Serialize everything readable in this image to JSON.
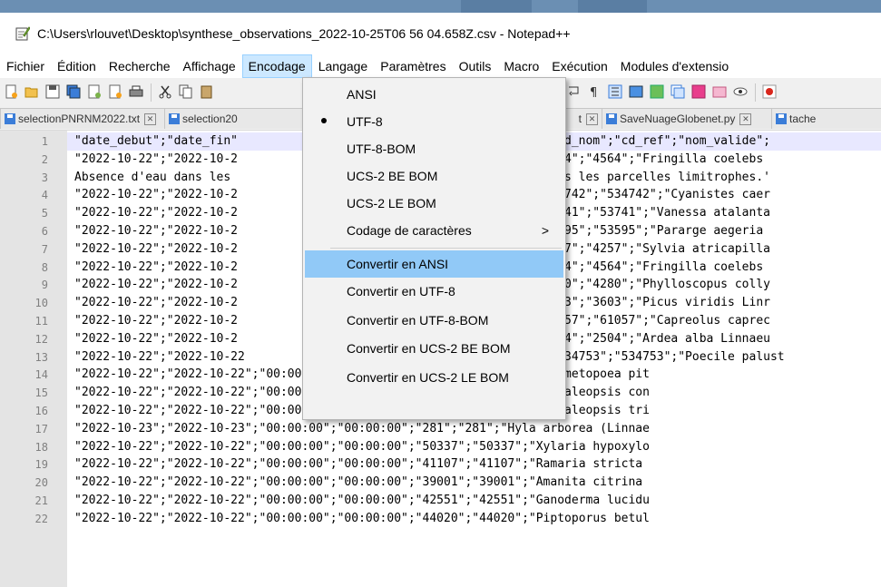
{
  "window": {
    "title": "C:\\Users\\rlouvet\\Desktop\\synthese_observations_2022-10-25T06 56 04.658Z.csv - Notepad++"
  },
  "menu": [
    "Fichier",
    "Édition",
    "Recherche",
    "Affichage",
    "Encodage",
    "Langage",
    "Paramètres",
    "Outils",
    "Macro",
    "Exécution",
    "Modules d'extensio"
  ],
  "menu_active": "Encodage",
  "tabs": [
    "selectionPNRNM2022.txt",
    "selection20",
    "t",
    "SaveNuageGlobenet.py",
    "tache"
  ],
  "dropdown": {
    "items": [
      "ANSI",
      "UTF-8",
      "UTF-8-BOM",
      "UCS-2 BE BOM",
      "UCS-2 LE BOM",
      "Codage de caractères",
      "Convertir en ANSI",
      "Convertir en UTF-8",
      "Convertir en UTF-8-BOM",
      "Convertir en UCS-2 BE BOM",
      "Convertir en UCS-2 LE BOM"
    ],
    "selected": "UTF-8",
    "highlighted": "Convertir en ANSI",
    "submenu_arrow": ">"
  },
  "editor": {
    "lines": [
      {
        "n": "1",
        "left": "\"date_debut\";\"date_fin\"",
        "right": "d_nom\";\"cd_ref\";\"nom_valide\";"
      },
      {
        "n": "2",
        "left": "\"2022-10-22\";\"2022-10-2",
        "right": "4\";\"4564\";\"Fringilla coelebs"
      },
      {
        "n": "3",
        "left": "Absence d'eau dans les",
        "right": "s les parcelles limitrophes.'"
      },
      {
        "n": "4",
        "left": "\"2022-10-22\";\"2022-10-2",
        "right": "742\";\"534742\";\"Cyanistes caer"
      },
      {
        "n": "5",
        "left": "\"2022-10-22\";\"2022-10-2",
        "right": "41\";\"53741\";\"Vanessa atalanta"
      },
      {
        "n": "6",
        "left": "\"2022-10-22\";\"2022-10-2",
        "right": "95\";\"53595\";\"Pararge aegeria"
      },
      {
        "n": "7",
        "left": "\"2022-10-22\";\"2022-10-2",
        "right": "7\";\"4257\";\"Sylvia atricapilla"
      },
      {
        "n": "8",
        "left": "\"2022-10-22\";\"2022-10-2",
        "right": "4\";\"4564\";\"Fringilla coelebs"
      },
      {
        "n": "9",
        "left": "\"2022-10-22\";\"2022-10-2",
        "right": "0\";\"4280\";\"Phylloscopus colly"
      },
      {
        "n": "10",
        "left": "\"2022-10-22\";\"2022-10-2",
        "right": "3\";\"3603\";\"Picus viridis Linr"
      },
      {
        "n": "11",
        "left": "\"2022-10-22\";\"2022-10-2",
        "right": "57\";\"61057\";\"Capreolus caprec"
      },
      {
        "n": "12",
        "left": "\"2022-10-22\";\"2022-10-2",
        "right": "4\";\"2504\";\"Ardea alba Linnaeu"
      },
      {
        "n": "13",
        "left": "\"2022-10-22\";\"2022-10-22",
        "right": "34753\";\"534753\";\"Poecile palust"
      },
      {
        "n": "14",
        "left": "\"2022-10-22\";\"2022-10-22\";\"00:00:00\";\"00:00:00\";\"54674\";\"54674\";\"Thaumetopoea pit",
        "right": ""
      },
      {
        "n": "15",
        "left": "\"2022-10-22\";\"2022-10-22\";\"00:00:00\";\"00:00:00\";\"42189\";\"42189\";\"Daedaleopsis con",
        "right": ""
      },
      {
        "n": "16",
        "left": "\"2022-10-22\";\"2022-10-22\";\"00:00:00\";\"00:00:00\";\"42194\";\"42194\";\"Daedaleopsis tri",
        "right": ""
      },
      {
        "n": "17",
        "left": "\"2022-10-23\";\"2022-10-23\";\"00:00:00\";\"00:00:00\";\"281\";\"281\";\"Hyla arborea (Linnae",
        "right": ""
      },
      {
        "n": "18",
        "left": "\"2022-10-22\";\"2022-10-22\";\"00:00:00\";\"00:00:00\";\"50337\";\"50337\";\"Xylaria hypoxylo",
        "right": ""
      },
      {
        "n": "19",
        "left": "\"2022-10-22\";\"2022-10-22\";\"00:00:00\";\"00:00:00\";\"41107\";\"41107\";\"Ramaria stricta",
        "right": ""
      },
      {
        "n": "20",
        "left": "\"2022-10-22\";\"2022-10-22\";\"00:00:00\";\"00:00:00\";\"39001\";\"39001\";\"Amanita citrina",
        "right": ""
      },
      {
        "n": "21",
        "left": "\"2022-10-22\";\"2022-10-22\";\"00:00:00\";\"00:00:00\";\"42551\";\"42551\";\"Ganoderma lucidu",
        "right": ""
      },
      {
        "n": "22",
        "left": "\"2022-10-22\";\"2022-10-22\";\"00:00:00\";\"00:00:00\";\"44020\";\"44020\";\"Piptoporus betul",
        "right": ""
      }
    ]
  },
  "colors": {
    "menu_active_bg": "#cce8ff",
    "dropdown_highlight": "#91c9f7",
    "gutter_bg": "#e4e4e4",
    "current_line_bg": "#e8e8ff"
  }
}
